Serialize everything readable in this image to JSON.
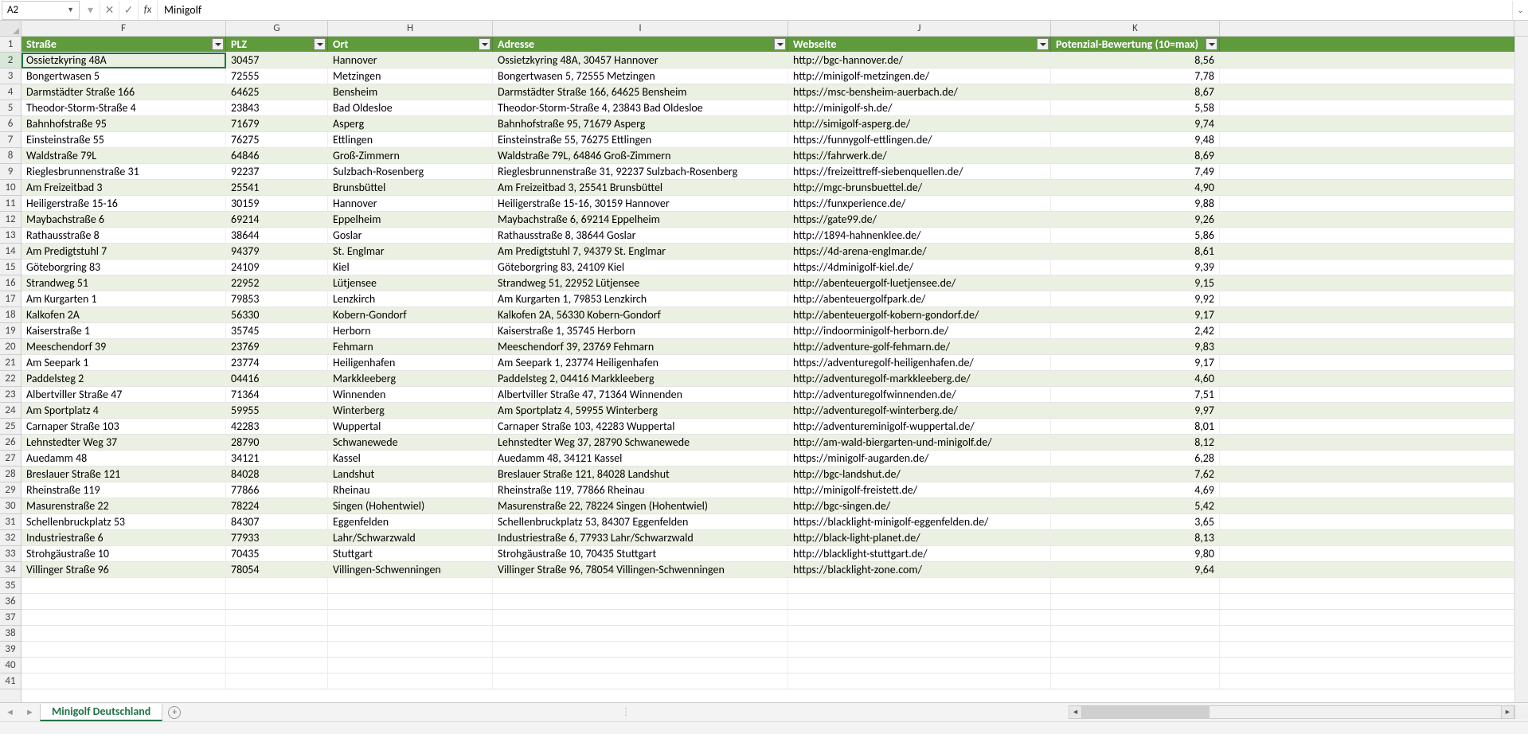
{
  "nameBox": "A2",
  "formula": "Minigolf",
  "sheetTab": "Minigolf Deutschland",
  "colLetters": [
    "F",
    "G",
    "H",
    "I",
    "J",
    "K"
  ],
  "headers": {
    "F": "Straße",
    "G": "PLZ",
    "H": "Ort",
    "I": "Adresse",
    "J": "Webseite",
    "K": "Potenzial-Bewertung (10=max)"
  },
  "rows": [
    {
      "n": 2,
      "F": "Ossietzkyring 48A",
      "G": "30457",
      "H": "Hannover",
      "I": "Ossietzkyring 48A, 30457 Hannover",
      "J": "http://bgc-hannover.de/",
      "K": "8,56"
    },
    {
      "n": 3,
      "F": "Bongertwasen 5",
      "G": "72555",
      "H": "Metzingen",
      "I": "Bongertwasen 5, 72555 Metzingen",
      "J": "http://minigolf-metzingen.de/",
      "K": "7,78"
    },
    {
      "n": 4,
      "F": "Darmstädter Straße 166",
      "G": "64625",
      "H": "Bensheim",
      "I": "Darmstädter Straße 166, 64625 Bensheim",
      "J": "https://msc-bensheim-auerbach.de/",
      "K": "8,67"
    },
    {
      "n": 5,
      "F": "Theodor-Storm-Straße 4",
      "G": "23843",
      "H": "Bad Oldesloe",
      "I": "Theodor-Storm-Straße 4, 23843 Bad Oldesloe",
      "J": "http://minigolf-sh.de/",
      "K": "5,58"
    },
    {
      "n": 6,
      "F": "Bahnhofstraße 95",
      "G": "71679",
      "H": "Asperg",
      "I": "Bahnhofstraße 95, 71679 Asperg",
      "J": "http://simigolf-asperg.de/",
      "K": "9,74"
    },
    {
      "n": 7,
      "F": "Einsteinstraße 55",
      "G": "76275",
      "H": "Ettlingen",
      "I": "Einsteinstraße 55, 76275 Ettlingen",
      "J": "https://funnygolf-ettlingen.de/",
      "K": "9,48"
    },
    {
      "n": 8,
      "F": "Waldstraße 79L",
      "G": "64846",
      "H": "Groß-Zimmern",
      "I": "Waldstraße 79L, 64846 Groß-Zimmern",
      "J": "https://fahrwerk.de/",
      "K": "8,69"
    },
    {
      "n": 9,
      "F": "Rieglesbrunnenstraße 31",
      "G": "92237",
      "H": "Sulzbach-Rosenberg",
      "I": "Rieglesbrunnenstraße 31, 92237 Sulzbach-Rosenberg",
      "J": "https://freizeittreff-siebenquellen.de/",
      "K": "7,49"
    },
    {
      "n": 10,
      "F": "Am Freizeitbad 3",
      "G": "25541",
      "H": "Brunsbüttel",
      "I": "Am Freizeitbad 3, 25541 Brunsbüttel",
      "J": "http://mgc-brunsbuettel.de/",
      "K": "4,90"
    },
    {
      "n": 11,
      "F": "Heiligerstraße 15-16",
      "G": "30159",
      "H": "Hannover",
      "I": "Heiligerstraße 15-16, 30159 Hannover",
      "J": "https://funxperience.de/",
      "K": "9,88"
    },
    {
      "n": 12,
      "F": "Maybachstraße 6",
      "G": "69214",
      "H": "Eppelheim",
      "I": "Maybachstraße 6, 69214 Eppelheim",
      "J": "https://gate99.de/",
      "K": "9,26"
    },
    {
      "n": 13,
      "F": "Rathausstraße 8",
      "G": "38644",
      "H": "Goslar",
      "I": "Rathausstraße 8, 38644 Goslar",
      "J": "http://1894-hahnenklee.de/",
      "K": "5,86"
    },
    {
      "n": 14,
      "F": "Am Predigtstuhl 7",
      "G": "94379",
      "H": "St. Englmar",
      "I": "Am Predigtstuhl 7, 94379 St. Englmar",
      "J": "https://4d-arena-englmar.de/",
      "K": "8,61"
    },
    {
      "n": 15,
      "F": "Göteborgring 83",
      "G": "24109",
      "H": "Kiel",
      "I": "Göteborgring 83, 24109 Kiel",
      "J": "https://4dminigolf-kiel.de/",
      "K": "9,39"
    },
    {
      "n": 16,
      "F": "Strandweg 51",
      "G": "22952",
      "H": "Lütjensee",
      "I": "Strandweg 51, 22952 Lütjensee",
      "J": "http://abenteuergolf-luetjensee.de/",
      "K": "9,15"
    },
    {
      "n": 17,
      "F": "Am Kurgarten 1",
      "G": "79853",
      "H": "Lenzkirch",
      "I": "Am Kurgarten 1, 79853 Lenzkirch",
      "J": "http://abenteuergolfpark.de/",
      "K": "9,92"
    },
    {
      "n": 18,
      "F": "Kalkofen 2A",
      "G": "56330",
      "H": "Kobern-Gondorf",
      "I": "Kalkofen 2A, 56330 Kobern-Gondorf",
      "J": "http://abenteuergolf-kobern-gondorf.de/",
      "K": "9,17"
    },
    {
      "n": 19,
      "F": "Kaiserstraße 1",
      "G": "35745",
      "H": "Herborn",
      "I": "Kaiserstraße 1, 35745 Herborn",
      "J": "http://indoorminigolf-herborn.de/",
      "K": "2,42"
    },
    {
      "n": 20,
      "F": "Meeschendorf 39",
      "G": "23769",
      "H": "Fehmarn",
      "I": "Meeschendorf 39, 23769 Fehmarn",
      "J": "http://adventure-golf-fehmarn.de/",
      "K": "9,83"
    },
    {
      "n": 21,
      "F": "Am Seepark 1",
      "G": "23774",
      "H": "Heiligenhafen",
      "I": "Am Seepark 1, 23774 Heiligenhafen",
      "J": "https://adventuregolf-heiligenhafen.de/",
      "K": "9,17"
    },
    {
      "n": 22,
      "F": "Paddelsteg 2",
      "G": "04416",
      "H": "Markkleeberg",
      "I": "Paddelsteg 2, 04416 Markkleeberg",
      "J": "http://adventuregolf-markkleeberg.de/",
      "K": "4,60"
    },
    {
      "n": 23,
      "F": "Albertviller Straße 47",
      "G": "71364",
      "H": "Winnenden",
      "I": "Albertviller Straße 47, 71364 Winnenden",
      "J": "http://adventuregolfwinnenden.de/",
      "K": "7,51"
    },
    {
      "n": 24,
      "F": "Am Sportplatz 4",
      "G": "59955",
      "H": "Winterberg",
      "I": "Am Sportplatz 4, 59955 Winterberg",
      "J": "http://adventuregolf-winterberg.de/",
      "K": "9,97"
    },
    {
      "n": 25,
      "F": "Carnaper Straße 103",
      "G": "42283",
      "H": "Wuppertal",
      "I": "Carnaper Straße 103, 42283 Wuppertal",
      "J": "http://adventureminigolf-wuppertal.de/",
      "K": "8,01"
    },
    {
      "n": 26,
      "F": "Lehnstedter Weg 37",
      "G": "28790",
      "H": "Schwanewede",
      "I": "Lehnstedter Weg 37, 28790 Schwanewede",
      "J": "http://am-wald-biergarten-und-minigolf.de/",
      "K": "8,12"
    },
    {
      "n": 27,
      "F": "Auedamm 48",
      "G": "34121",
      "H": "Kassel",
      "I": "Auedamm 48, 34121 Kassel",
      "J": "https://minigolf-augarden.de/",
      "K": "6,28"
    },
    {
      "n": 28,
      "F": "Breslauer Straße 121",
      "G": "84028",
      "H": "Landshut",
      "I": "Breslauer Straße 121, 84028 Landshut",
      "J": "http://bgc-landshut.de/",
      "K": "7,62"
    },
    {
      "n": 29,
      "F": "Rheinstraße 119",
      "G": "77866",
      "H": "Rheinau",
      "I": "Rheinstraße 119, 77866 Rheinau",
      "J": "http://minigolf-freistett.de/",
      "K": "4,69"
    },
    {
      "n": 30,
      "F": "Masurenstraße 22",
      "G": "78224",
      "H": "Singen (Hohentwiel)",
      "I": "Masurenstraße 22, 78224 Singen (Hohentwiel)",
      "J": "http://bgc-singen.de/",
      "K": "5,42"
    },
    {
      "n": 31,
      "F": "Schellenbruckplatz 53",
      "G": "84307",
      "H": "Eggenfelden",
      "I": "Schellenbruckplatz 53, 84307 Eggenfelden",
      "J": "https://blacklight-minigolf-eggenfelden.de/",
      "K": "3,65"
    },
    {
      "n": 32,
      "F": "Industriestraße 6",
      "G": "77933",
      "H": "Lahr/Schwarzwald",
      "I": "Industriestraße 6, 77933 Lahr/Schwarzwald",
      "J": "http://black-light-planet.de/",
      "K": "8,13"
    },
    {
      "n": 33,
      "F": "Strohgäustraße 10",
      "G": "70435",
      "H": "Stuttgart",
      "I": "Strohgäustraße 10, 70435 Stuttgart",
      "J": "http://blacklight-stuttgart.de/",
      "K": "9,80"
    },
    {
      "n": 34,
      "F": "Villinger Straße 96",
      "G": "78054",
      "H": "Villingen-Schwenningen",
      "I": "Villinger Straße 96, 78054 Villingen-Schwenningen",
      "J": "https://blacklight-zone.com/",
      "K": "9,64"
    }
  ]
}
